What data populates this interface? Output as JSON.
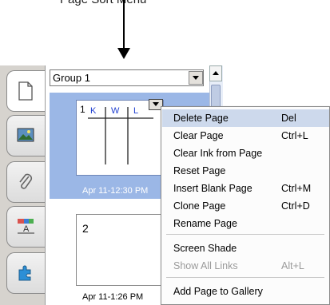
{
  "caption": "Page Sort Menu",
  "sidebar": {
    "group_select": {
      "value": "Group 1"
    }
  },
  "pages": [
    {
      "number": "1",
      "date": "Apr 11-12:30 PM",
      "selected": true,
      "column_letters": [
        "K",
        "W",
        "L"
      ]
    },
    {
      "number": "2",
      "date": "Apr 11-1:26 PM",
      "selected": false
    }
  ],
  "context_menu": {
    "items": [
      {
        "label": "Delete Page",
        "shortcut": "Del",
        "highlighted": true,
        "disabled": false
      },
      {
        "label": "Clear Page",
        "shortcut": "Ctrl+L",
        "disabled": false
      },
      {
        "label": "Clear Ink from Page",
        "shortcut": "",
        "disabled": false
      },
      {
        "label": "Reset Page",
        "shortcut": "",
        "disabled": false
      },
      {
        "label": "Insert Blank Page",
        "shortcut": "Ctrl+M",
        "disabled": false
      },
      {
        "label": "Clone Page",
        "shortcut": "Ctrl+D",
        "disabled": false
      },
      {
        "label": "Rename Page",
        "shortcut": "",
        "disabled": false
      },
      {
        "label": "Screen Shade",
        "shortcut": "",
        "disabled": false
      },
      {
        "label": "Show All Links",
        "shortcut": "Alt+L",
        "disabled": true
      },
      {
        "label": "Add Page to Gallery",
        "shortcut": "",
        "disabled": false
      }
    ]
  },
  "colors": {
    "selection_bg": "#9bb7e6",
    "menu_highlight": "#cdd9ec",
    "thumbnail_letters": "#1f3fd0"
  }
}
